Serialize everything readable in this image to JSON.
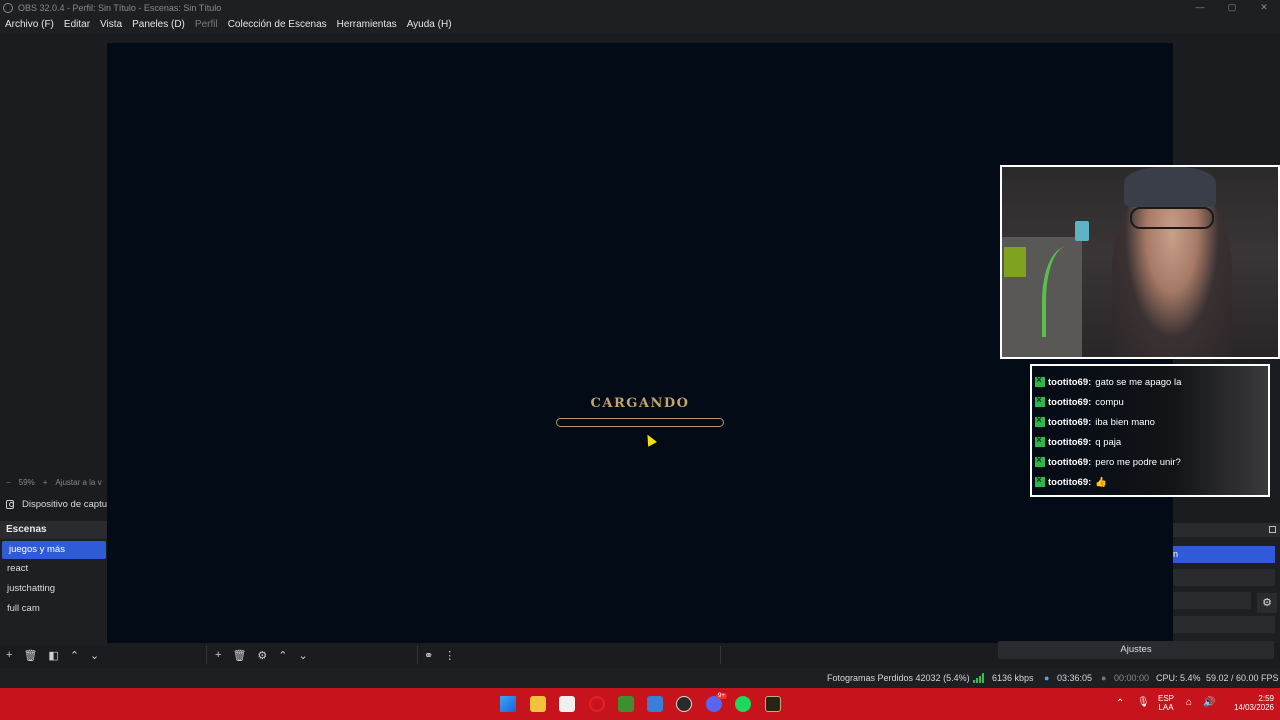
{
  "window": {
    "title": "OBS 32.0.4 - Perfil: Sin Título - Escenas: Sin Título",
    "controls": [
      "—",
      "▢",
      "✕"
    ]
  },
  "menu": [
    {
      "label": "Archivo (F)",
      "enabled": true
    },
    {
      "label": "Editar",
      "enabled": true
    },
    {
      "label": "Vista",
      "enabled": true
    },
    {
      "label": "Paneles (D)",
      "enabled": true
    },
    {
      "label": "Perfil",
      "enabled": false
    },
    {
      "label": "Colección de Escenas",
      "enabled": true
    },
    {
      "label": "Herramientas",
      "enabled": true
    },
    {
      "label": "Ayuda (H)",
      "enabled": true
    }
  ],
  "preview": {
    "zoom_label": "59%",
    "zoom_minus": "−",
    "zoom_plus": "+",
    "fit_label": "Ajustar a la v",
    "loading_text": "CARGANDO",
    "loading_progress": 0
  },
  "sources": {
    "first_item": "Dispositivo de captu",
    "icon": "camera-icon"
  },
  "scenes": {
    "header": "Escenas",
    "items": [
      "juegos y más",
      "react",
      "justchatting",
      "full cam"
    ],
    "active_index": 0
  },
  "chat": {
    "badge_color": "#2fb84a",
    "messages": [
      {
        "user": "tootito69:",
        "text": "gato se me apago la"
      },
      {
        "user": "tootito69:",
        "text": "compu"
      },
      {
        "user": "tootito69:",
        "text": "iba bien mano"
      },
      {
        "user": "tootito69:",
        "text": "q paja"
      },
      {
        "user": "tootito69:",
        "text": "pero me podre unir?"
      },
      {
        "user": "tootito69:",
        "text": "👍"
      }
    ]
  },
  "controls_dock": {
    "active_button_fragment": "n",
    "settings_label": "Ajustes"
  },
  "toolbar": {
    "add": "+",
    "remove": "🗑",
    "filter": "◧",
    "up": "⌃",
    "down": "⌄",
    "settings": "⚙",
    "more": "⋮",
    "link": "⚭"
  },
  "status": {
    "dropped_frames": "Fotogramas Perdidos 42032 (5.4%)",
    "bitrate": "6136 kbps",
    "stream_time": "03:36:05",
    "rec_time": "00:00:00",
    "cpu": "CPU: 5.4%",
    "fps": "59.02 / 60.00 FPS",
    "accent_live": "#33c04a"
  },
  "taskbar": {
    "color": "#c7131b",
    "apps": [
      "windows-start-icon",
      "file-explorer-icon",
      "store-icon",
      "opera-icon",
      "minecraft-icon",
      "photos-icon",
      "obs-icon",
      "discord-icon",
      "spotify-icon",
      "league-icon"
    ],
    "discord_badge": "9+",
    "lang_top": "ESP",
    "lang_bottom": "LAA",
    "time": "2:59",
    "date": "14/03/2026"
  },
  "colors": {
    "accent": "#2f5bd8",
    "preview_bg": "#020b16",
    "loading_gold": "#c3a46c"
  }
}
